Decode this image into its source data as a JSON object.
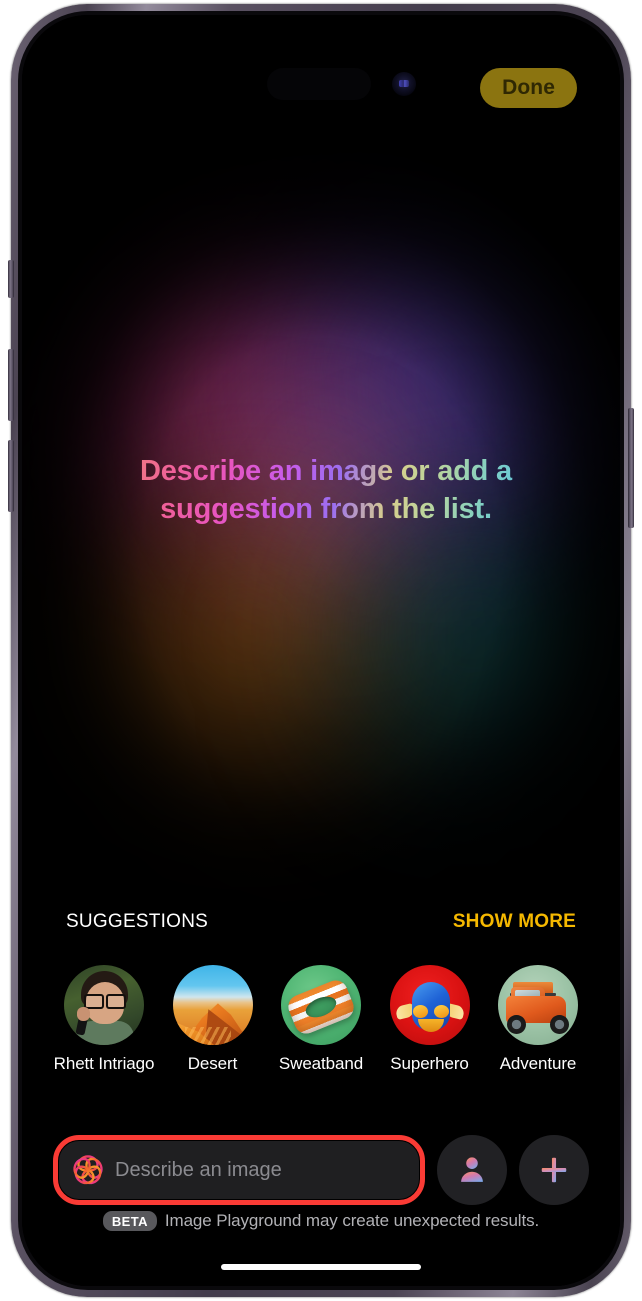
{
  "app": {
    "name": "Image Playground"
  },
  "status_bar": {
    "dynamic_island": "dynamic-island",
    "front_camera_icon": "front-camera-icon"
  },
  "header": {
    "done_label": "Done",
    "done_bg_color": "#8b7410",
    "done_text_color": "#2f2803"
  },
  "hero": {
    "prompt_text": "Describe an image or add a suggestion from the list."
  },
  "suggestions": {
    "section_title": "SUGGESTIONS",
    "show_more_label": "SHOW MORE",
    "show_more_color": "#f5b800",
    "items": [
      {
        "label": "Rhett Intriago",
        "thumb": "person-photo"
      },
      {
        "label": "Desert",
        "thumb": "desert-dunes"
      },
      {
        "label": "Sweatband",
        "thumb": "sweatband"
      },
      {
        "label": "Superhero",
        "thumb": "superhero-mask"
      },
      {
        "label": "Adventure",
        "thumb": "offroad-jeep"
      }
    ]
  },
  "input_bar": {
    "describe_placeholder": "Describe an image",
    "describe_value": "",
    "sparkle_icon": "apple-intelligence-icon",
    "person_button_icon": "person-icon",
    "add_button_icon": "plus-icon",
    "highlight_color": "#fa3b35"
  },
  "footer": {
    "badge": "BETA",
    "note": "Image Playground may create unexpected results."
  }
}
